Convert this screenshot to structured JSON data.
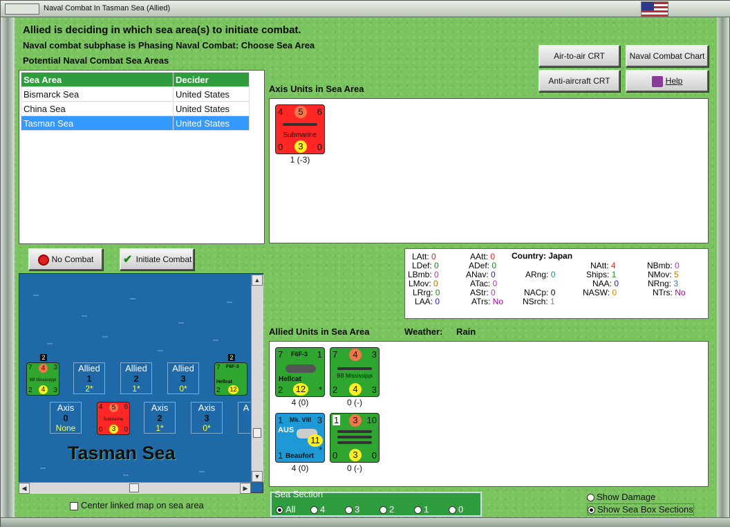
{
  "window": {
    "title": "Naval Combat In Tasman Sea (Allied)"
  },
  "header": {
    "line1": "Allied is deciding in which sea area(s) to initiate combat.",
    "line2": "Naval combat subphase is Phasing Naval Combat: Choose Sea Area",
    "line3": "Potential Naval Combat Sea Areas"
  },
  "buttons": {
    "air_to_air": "Air-to-air CRT",
    "naval_chart": "Naval Combat Chart",
    "anti_aircraft": "Anti-aircraft CRT",
    "help": "Help",
    "no_combat": "No Combat",
    "initiate": "Initiate Combat"
  },
  "sea_table": {
    "headers": [
      "Sea Area",
      "Decider"
    ],
    "rows": [
      [
        "Bismarck Sea",
        "United States"
      ],
      [
        "China Sea",
        "United States"
      ],
      [
        "Tasman Sea",
        "United States"
      ]
    ],
    "selected": 2
  },
  "axis_units": {
    "title": "Axis Units in Sea Area",
    "units": [
      {
        "tl": "4",
        "tc": "5",
        "tr": "6",
        "name": "Submarine",
        "bl": "0",
        "bc": "3",
        "br": "0",
        "caption": "1 (-3)"
      }
    ]
  },
  "stats": {
    "LAtt_l": "LAtt:",
    "LAtt": "0",
    "LDef_l": "LDef:",
    "LDef": "0",
    "LBmb_l": "LBmb:",
    "LBmb": "0",
    "LMov_l": "LMov:",
    "LMov": "0",
    "LRrg_l": "LRrg:",
    "LRrg": "0",
    "LAA_l": "LAA:",
    "LAA": "0",
    "AAtt_l": "AAtt:",
    "AAtt": "0",
    "ADef_l": "ADef:",
    "ADef": "0",
    "ANav_l": "ANav:",
    "ANav": "0",
    "ATac_l": "ATac:",
    "ATac": "0",
    "AStr_l": "AStr:",
    "AStr": "0",
    "ATrs_l": "ATrs:",
    "ATrs": "No",
    "country_l": "Country:",
    "country": "Japan",
    "ARng_l": "ARng:",
    "ARng": "0",
    "NACp_l": "NACp:",
    "NACp": "0",
    "NSrch_l": "NSrch:",
    "NSrch": "1",
    "NAtt_l": "NAtt:",
    "NAtt": "4",
    "Ships_l": "Ships:",
    "Ships": "1",
    "NAA_l": "NAA:",
    "NAA": "0",
    "NASW_l": "NASW:",
    "NASW": "0",
    "NBmb_l": "NBmb:",
    "NBmb": "0",
    "NMov_l": "NMov:",
    "NMov": "5",
    "NRng_l": "NRng:",
    "NRng": "3",
    "NTrs_l": "NTrs:",
    "NTrs": "No"
  },
  "allied_units": {
    "title": "Allied Units in Sea Area",
    "weather_label": "Weather:",
    "weather": "Rain",
    "units": [
      {
        "tl": "7",
        "tm": "F6F-3",
        "tr": "1",
        "name": "Hellcat",
        "bl": "2",
        "bc": "12",
        "br": "*",
        "caption": "4 (0)"
      },
      {
        "tl": "7",
        "tc": "4",
        "tr": "3",
        "name": "BB Mississippi",
        "bl": "2",
        "bc": "4",
        "br": "3",
        "caption": "0 (-)"
      },
      {
        "tl": "1",
        "tm": "Mk. VIII",
        "tr": "3",
        "nat": "AUS",
        "name": "Beaufort",
        "bl": "1",
        "bc": "11",
        "br": "*",
        "caption": "4 (0)"
      },
      {
        "tl": "1",
        "tc": "3",
        "tr": "10",
        "bl": "0",
        "bc": "3",
        "br": "0",
        "caption": "0 (-)"
      }
    ]
  },
  "map": {
    "title": "Tasman Sea",
    "allied_boxes": [
      {
        "name": "Allied",
        "num": "1",
        "val": "2*"
      },
      {
        "name": "Allied",
        "num": "2",
        "val": "1*"
      },
      {
        "name": "Allied",
        "num": "3",
        "val": "0*"
      }
    ],
    "axis_boxes": [
      {
        "name": "Axis",
        "num": "0",
        "val": "None"
      },
      {
        "name": "Axis",
        "num": "2",
        "val": "1*"
      },
      {
        "name": "Axis",
        "num": "3",
        "val": "0*"
      },
      {
        "name": "A"
      }
    ],
    "stack_left": "2",
    "stack_right": "2",
    "mini_left": {
      "tl": "7",
      "tc": "4",
      "tr": "3",
      "name": "BB Mississippi",
      "bl": "2",
      "bc": "4",
      "br": "3"
    },
    "mini_right": {
      "tm": "F6F-3",
      "tl": "7",
      "name": "Hellcat",
      "bl": "2",
      "bc": "12"
    },
    "mini_sub": {
      "tl": "4",
      "tc": "5",
      "tr": "6",
      "name": "Submarine",
      "bl": "0",
      "bc": "3",
      "br": "0"
    }
  },
  "center_linked": "Center linked map on sea area",
  "sea_section": {
    "label": "Sea Section",
    "options": [
      "All",
      "4",
      "3",
      "2",
      "1",
      "0"
    ],
    "selected": "All"
  },
  "show_damage": "Show Damage",
  "show_sea_box": "Show Sea Box Sections"
}
